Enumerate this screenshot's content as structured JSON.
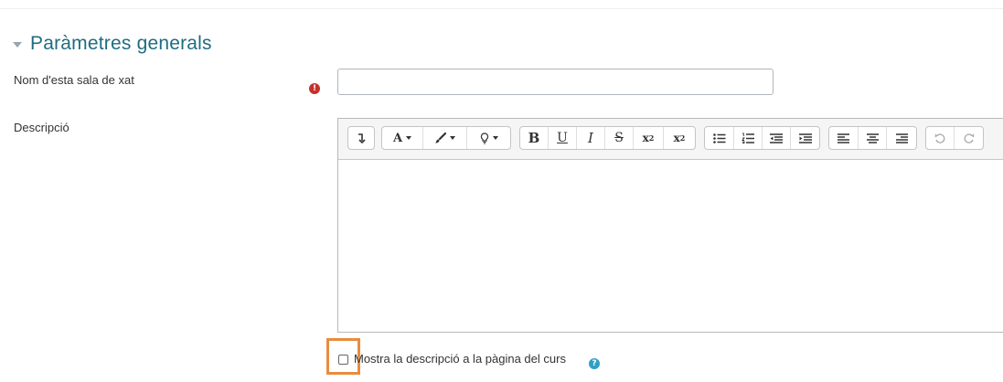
{
  "section": {
    "title": "Paràmetres generals"
  },
  "fields": {
    "name": {
      "label": "Nom d'esta sala de xat",
      "value": "",
      "required_icon": "!"
    },
    "description": {
      "label": "Descripció"
    }
  },
  "editor": {
    "toolbar_groups": [
      [
        "collapse-icon"
      ],
      [
        "font-color-icon",
        "highlight-brush-icon",
        "lightbulb-icon"
      ],
      [
        "bold-icon",
        "underline-icon",
        "italic-icon",
        "strikethrough-icon",
        "subscript-icon",
        "superscript-icon"
      ],
      [
        "bullet-list-icon",
        "numbered-list-icon",
        "outdent-icon",
        "indent-icon"
      ],
      [
        "align-left-icon",
        "align-center-icon",
        "align-right-icon"
      ],
      [
        "undo-icon",
        "redo-icon"
      ]
    ],
    "content": ""
  },
  "show_description": {
    "label": "Mostra la descripció a la pàgina del curs",
    "checked": false,
    "help_icon": "?"
  },
  "colors": {
    "title": "#1f6c80",
    "required": "#c7302a",
    "help": "#2f9fc6",
    "highlight": "#e98c3e"
  }
}
